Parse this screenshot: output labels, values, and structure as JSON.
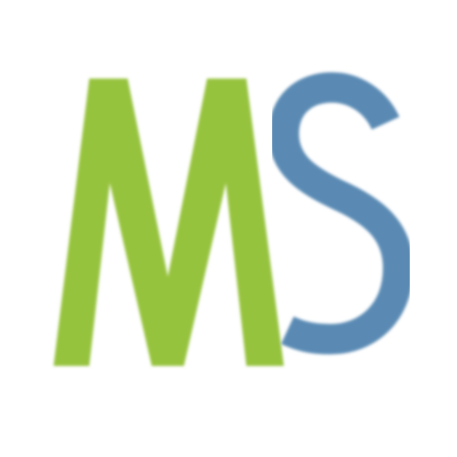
{
  "logo": {
    "text": "MS",
    "letters": [
      {
        "char": "M",
        "color": "#96c33c"
      },
      {
        "char": "S",
        "color": "#5a8ab4"
      }
    ],
    "background_color": "#ffffff"
  }
}
